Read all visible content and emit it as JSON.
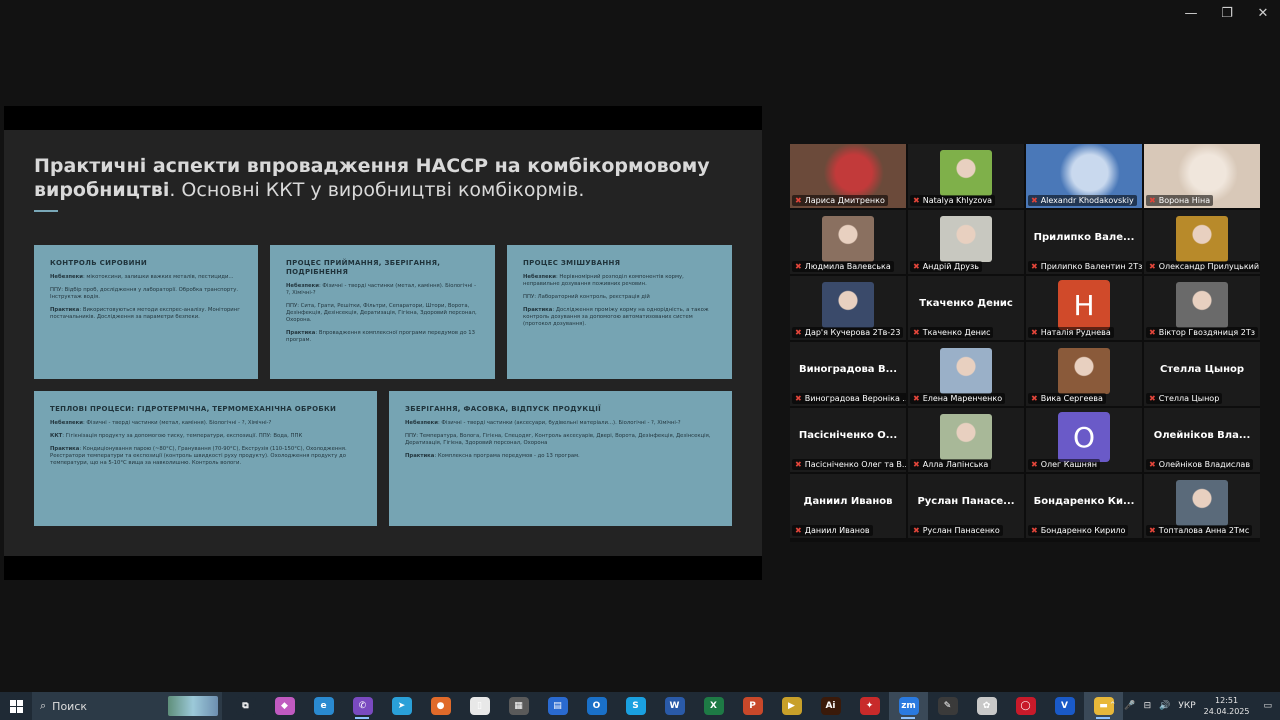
{
  "window_controls": {
    "minimize": "—",
    "restore": "❐",
    "close": "✕"
  },
  "slide": {
    "title_bold": "Практичні аспекти впровадження НАССР на комбікормовому виробництві",
    "title_rest": ". Основні ККТ у виробництві комбікормів.",
    "boxes": [
      {
        "heading": "КОНТРОЛЬ СИРОВИНИ",
        "lines": [
          {
            "label": "Небезпеки",
            "text": ": мікотоксини, залишки важких металів, пестициди..."
          },
          {
            "label": "",
            "text": "ППУ: Відбір проб, дослідження у лабораторії. Обробка транспорту. Інструктаж водія."
          },
          {
            "label": "Практика",
            "text": ": Використовуються методи експрес-аналізу. Моніторинг постачальників. Дослідження за параметри безпеки."
          }
        ]
      },
      {
        "heading": "ПРОЦЕС ПРИЙМАННЯ, ЗБЕРІГАННЯ, ПОДРІБНЕННЯ",
        "lines": [
          {
            "label": "Небезпеки",
            "text": ": Фізичні - тверді частинки (метал, каміння). Біологічні - ?, Хімічні-?"
          },
          {
            "label": "",
            "text": "ППУ: Сита, Грати, Решітки, Фільтри, Сепаратори, Штори, Ворота, Дезінфекція, Дезінсекція, Дератизація, Гігієна, Здоровий персонал, Охорона."
          },
          {
            "label": "Практика",
            "text": ": Впровадження комплексної програми передумов до 13 програм."
          }
        ]
      },
      {
        "heading": "ПРОЦЕС ЗМІШУВАННЯ",
        "lines": [
          {
            "label": "Небезпеки",
            "text": ": Нерівномірний розподіл компонентів корму, неправильне дозування поживних речовин."
          },
          {
            "label": "",
            "text": "ППУ: Лабораторний контроль, реєстрація дій"
          },
          {
            "label": "Практика",
            "text": ": Дослідження проміжу корму на однорідність, а також контроль дозування за допомогою автоматизованих систем (протокол дозування)."
          }
        ]
      },
      {
        "heading": "ТЕПЛОВІ ПРОЦЕСИ: ГІДРОТЕРМІЧНА, ТЕРМОМЕХАНІЧНА ОБРОБКИ",
        "lines": [
          {
            "label": "Небезпеки",
            "text": ": Фізичні - тверді частинки (метал, каміння). Біологічні - ?, Хімічні-?"
          },
          {
            "label": "ККТ",
            "text": ": Гігієнізація продукту за допомогою тиску, температури, експозиції. ППУ: Вода, ППК"
          },
          {
            "label": "Практика",
            "text": ": Кондиціонування парою (~80°С), Гранування (70-90°С), Екструзія (110-150°С), Охолодження. Реєстратори температури та експозиції (контроль швидкості руху продукту). Охолодження продукту до температури, що на 5-10°С вища за навколишню. Контроль вологи."
          }
        ]
      },
      {
        "heading": "ЗБЕРІГАННЯ, ФАСОВКА, ВІДПУСК ПРОДУКЦІЇ",
        "lines": [
          {
            "label": "Небезпеки",
            "text": ": Фізичні - тверді частинки (аксесуари, будівельні матеріали...). Біологічні - ?, Хімічні-?"
          },
          {
            "label": "",
            "text": "ППУ: Температура, Волога, Гігієна, Спецодяг, Контроль аксесуарів, Двері, Ворота, Дезінфекція, Дезінсекція, Дератизація, Гігієна, Здоровий персонал, Охорона"
          },
          {
            "label": "Практика",
            "text": ": Комплексна програма передумов - до 13 програм."
          }
        ]
      }
    ]
  },
  "participants": [
    {
      "name": "Лариса Дмитренко",
      "kind": "video",
      "bg": "#6b4a3a",
      "accent": "#c23a3a",
      "muted": true,
      "active": false,
      "big": ""
    },
    {
      "name": "Natalya Khlyzova",
      "kind": "thumb",
      "bg": "#1b1b1b",
      "accent": "#7fb04a",
      "muted": true,
      "active": false,
      "big": ""
    },
    {
      "name": "Alexandr Khodakovskiy",
      "kind": "video",
      "bg": "#4a78b8",
      "accent": "#c9d9ee",
      "muted": true,
      "active": true,
      "big": ""
    },
    {
      "name": "Ворона Ніна",
      "kind": "video",
      "bg": "#d8c8b8",
      "accent": "#f0e6dc",
      "muted": true,
      "active": false,
      "big": ""
    },
    {
      "name": "Людмила Валевська",
      "kind": "thumb",
      "bg": "#1b1b1b",
      "accent": "#8a7060",
      "muted": true,
      "active": false,
      "big": ""
    },
    {
      "name": "Андрій Друзь",
      "kind": "thumb",
      "bg": "#1b1b1b",
      "accent": "#c8c8c0",
      "muted": true,
      "active": false,
      "big": ""
    },
    {
      "name": "Прилипко Валентин 2Тз",
      "kind": "text",
      "bg": "#1b1b1b",
      "accent": "",
      "muted": true,
      "active": false,
      "big": "Прилипко Вале..."
    },
    {
      "name": "Олександр Прилуцький",
      "kind": "thumb",
      "bg": "#1b1b1b",
      "accent": "#b88a2a",
      "muted": true,
      "active": false,
      "big": ""
    },
    {
      "name": "Дар'я Кучерова 2Тв-23",
      "kind": "thumb",
      "bg": "#1b1b1b",
      "accent": "#3a4a6a",
      "muted": true,
      "active": false,
      "big": ""
    },
    {
      "name": "Ткаченко Денис",
      "kind": "text",
      "bg": "#1b1b1b",
      "accent": "",
      "muted": true,
      "active": false,
      "big": "Ткаченко Денис"
    },
    {
      "name": "Наталія Руднева",
      "kind": "letter",
      "bg": "#1b1b1b",
      "accent": "#d04a2a",
      "muted": true,
      "active": false,
      "big": "H"
    },
    {
      "name": "Віктор Гвоздяниця 2Тз",
      "kind": "thumb",
      "bg": "#1b1b1b",
      "accent": "#6a6a6a",
      "muted": true,
      "active": false,
      "big": ""
    },
    {
      "name": "Виноградова Вероніка ...",
      "kind": "text",
      "bg": "#1b1b1b",
      "accent": "",
      "muted": true,
      "active": false,
      "big": "Виноградова В..."
    },
    {
      "name": "Елена Маренченко",
      "kind": "thumb",
      "bg": "#1b1b1b",
      "accent": "#9ab0c8",
      "muted": true,
      "active": false,
      "big": ""
    },
    {
      "name": "Вика Сергеева",
      "kind": "thumb",
      "bg": "#1b1b1b",
      "accent": "#8a5a3a",
      "muted": true,
      "active": false,
      "big": ""
    },
    {
      "name": "Стелла Цынор",
      "kind": "text",
      "bg": "#1b1b1b",
      "accent": "",
      "muted": true,
      "active": false,
      "big": "Стелла Цынор"
    },
    {
      "name": "Пасісніченко Олег та В...",
      "kind": "text",
      "bg": "#1b1b1b",
      "accent": "",
      "muted": true,
      "active": false,
      "big": "Пасісніченко О..."
    },
    {
      "name": "Алла Лапінська",
      "kind": "thumb",
      "bg": "#1b1b1b",
      "accent": "#a8b898",
      "muted": true,
      "active": false,
      "big": ""
    },
    {
      "name": "Олег Кашнян",
      "kind": "letter",
      "bg": "#1b1b1b",
      "accent": "#6a5ac8",
      "muted": true,
      "active": false,
      "big": "O"
    },
    {
      "name": "Олейніков Владислав",
      "kind": "text",
      "bg": "#1b1b1b",
      "accent": "",
      "muted": true,
      "active": false,
      "big": "Олейніков Вла..."
    },
    {
      "name": "Даниил Иванов",
      "kind": "text",
      "bg": "#1b1b1b",
      "accent": "",
      "muted": true,
      "active": false,
      "big": "Даниил Иванов"
    },
    {
      "name": "Руслан Панасенко",
      "kind": "text",
      "bg": "#1b1b1b",
      "accent": "",
      "muted": true,
      "active": false,
      "big": "Руслан Панасе..."
    },
    {
      "name": "Бондаренко Кирило",
      "kind": "text",
      "bg": "#1b1b1b",
      "accent": "",
      "muted": true,
      "active": false,
      "big": "Бондаренко Ки..."
    },
    {
      "name": "Топталова Анна 2Тмс",
      "kind": "thumb",
      "bg": "#1b1b1b",
      "accent": "#5a6a7a",
      "muted": true,
      "active": false,
      "big": ""
    }
  ],
  "taskbar": {
    "search_placeholder": "Поиск",
    "apps": [
      {
        "icon": "task-view-icon",
        "glyph": "⧉",
        "color": "#1f2a35",
        "open": false,
        "hl": false
      },
      {
        "icon": "copilot-icon",
        "glyph": "◆",
        "color": "#c05ac0",
        "open": false,
        "hl": false
      },
      {
        "icon": "edge-icon",
        "glyph": "e",
        "color": "#2a8ad0",
        "open": false,
        "hl": false
      },
      {
        "icon": "viber-icon",
        "glyph": "✆",
        "color": "#7a4ac0",
        "open": true,
        "hl": false
      },
      {
        "icon": "telegram-icon",
        "glyph": "➤",
        "color": "#2aa0d8",
        "open": false,
        "hl": false
      },
      {
        "icon": "firefox-icon",
        "glyph": "●",
        "color": "#e06a2a",
        "open": false,
        "hl": false
      },
      {
        "icon": "file-icon",
        "glyph": "▯",
        "color": "#e8e8e8",
        "open": false,
        "hl": false
      },
      {
        "icon": "calculator-icon",
        "glyph": "▦",
        "color": "#5a5a5a",
        "open": false,
        "hl": false
      },
      {
        "icon": "calendar-icon",
        "glyph": "▤",
        "color": "#2a6ad0",
        "open": false,
        "hl": false
      },
      {
        "icon": "outlook-icon",
        "glyph": "O",
        "color": "#1a70c8",
        "open": false,
        "hl": false
      },
      {
        "icon": "skype-icon",
        "glyph": "S",
        "color": "#1aa0e0",
        "open": false,
        "hl": false
      },
      {
        "icon": "word-icon",
        "glyph": "W",
        "color": "#2a5aa8",
        "open": false,
        "hl": false
      },
      {
        "icon": "excel-icon",
        "glyph": "X",
        "color": "#1e7a45",
        "open": false,
        "hl": false
      },
      {
        "icon": "powerpoint-icon",
        "glyph": "P",
        "color": "#c8482a",
        "open": false,
        "hl": false
      },
      {
        "icon": "media-player-icon",
        "glyph": "▶",
        "color": "#c8a02a",
        "open": false,
        "hl": false
      },
      {
        "icon": "illustrator-icon",
        "glyph": "Ai",
        "color": "#3a1a0a",
        "open": false,
        "hl": false
      },
      {
        "icon": "map-icon",
        "glyph": "✦",
        "color": "#c82a2a",
        "open": false,
        "hl": false
      },
      {
        "icon": "zoom-icon",
        "glyph": "zm",
        "color": "#2a7ae0",
        "open": true,
        "hl": true
      },
      {
        "icon": "writer-icon",
        "glyph": "✎",
        "color": "#3a3a3a",
        "open": false,
        "hl": false
      },
      {
        "icon": "paint-icon",
        "glyph": "✿",
        "color": "#c8c8c8",
        "open": false,
        "hl": false
      },
      {
        "icon": "opera-icon",
        "glyph": "◯",
        "color": "#c81a2a",
        "open": false,
        "hl": false
      },
      {
        "icon": "app-v-icon",
        "glyph": "V",
        "color": "#1a5ac8",
        "open": false,
        "hl": false
      },
      {
        "icon": "explorer-icon",
        "glyph": "▬",
        "color": "#e8b83a",
        "open": true,
        "hl": true
      }
    ],
    "tray": {
      "chevron": "⌃",
      "mic": "🎤",
      "network": "⊟",
      "volume": "🔊",
      "lang": "УКР",
      "notif": "▭"
    },
    "time": "12:51",
    "date": "24.04.2025"
  }
}
